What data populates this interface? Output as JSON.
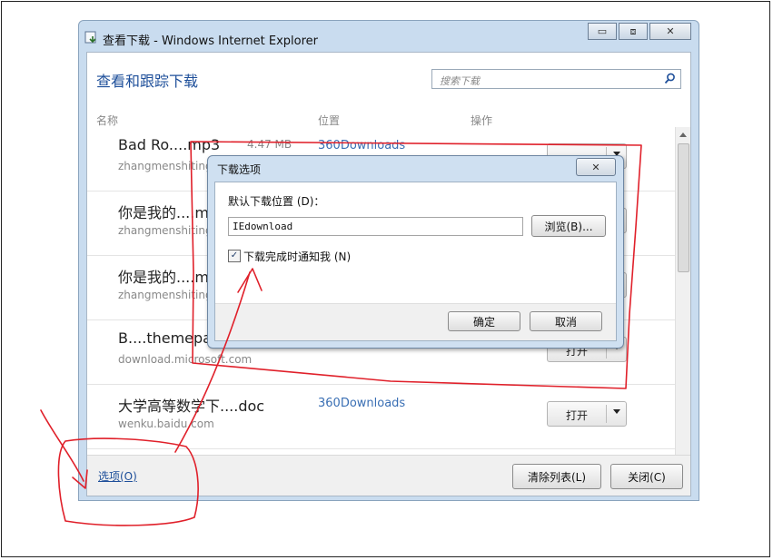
{
  "window": {
    "title": "查看下载 - Windows Internet Explorer",
    "buttons": {
      "minimize": "▭",
      "maximize": "⧈",
      "close": "✕"
    }
  },
  "header": {
    "title": "查看和跟踪下载",
    "search_placeholder": "搜索下载"
  },
  "columns": {
    "name": "名称",
    "location": "位置",
    "action": "操作"
  },
  "downloads": [
    {
      "name": "Bad Ro....mp3",
      "source": "zhangmenshiting",
      "size": "4.47 MB",
      "location": "360Downloads",
      "action": ""
    },
    {
      "name": "你是我的....m",
      "source": "zhangmenshiting",
      "size": "",
      "location": "",
      "action": ""
    },
    {
      "name": "你是我的....m",
      "source": "zhangmenshiting",
      "size": "",
      "location": "",
      "action": ""
    },
    {
      "name": "B....themepa",
      "source": "download.microsoft.com",
      "size": "",
      "location": "",
      "action": "打开"
    },
    {
      "name": "大学高等数学下....doc",
      "source": "wenku.baidu.com",
      "size": "",
      "location": "360Downloads",
      "action": "打开"
    }
  ],
  "footer": {
    "options_link": "选项(O)",
    "clear_list": "清除列表(L)",
    "close": "关闭(C)"
  },
  "dialog": {
    "title": "下载选项",
    "close": "✕",
    "default_location_label": "默认下载位置 (D)：",
    "default_location_value": "IEdownload",
    "browse": "浏览(B)...",
    "notify_label": "下载完成时通知我 (N)",
    "notify_checked": "✓",
    "ok": "确定",
    "cancel": "取消"
  },
  "colors": {
    "link": "#1e4f9a",
    "annotation": "#e0202a",
    "dialog_frame": "#cfe0f1"
  }
}
